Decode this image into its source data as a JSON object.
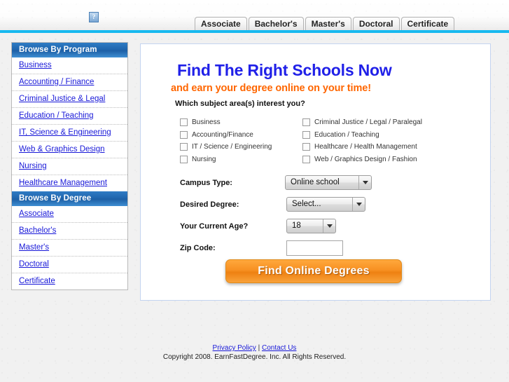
{
  "header": {
    "logo_alt_icon": "broken-image-icon",
    "logo_placeholder_glyph": "?",
    "nav_tabs": [
      {
        "label": "Associate"
      },
      {
        "label": "Bachelor's"
      },
      {
        "label": "Master's"
      },
      {
        "label": "Doctoral"
      },
      {
        "label": "Certificate"
      }
    ],
    "accent_color": "#17b9ef"
  },
  "sidebar": {
    "program_header": "Browse By Program",
    "program_items": [
      {
        "label": "Business"
      },
      {
        "label": "Accounting / Finance"
      },
      {
        "label": "Criminal Justice & Legal"
      },
      {
        "label": "Education / Teaching"
      },
      {
        "label": "IT, Science & Engineering"
      },
      {
        "label": "Web & Graphics Design"
      },
      {
        "label": "Nursing"
      },
      {
        "label": "Healthcare Management"
      }
    ],
    "degree_header": "Browse By Degree",
    "degree_items": [
      {
        "label": "Associate"
      },
      {
        "label": "Bachelor's"
      },
      {
        "label": "Master's"
      },
      {
        "label": "Doctoral"
      },
      {
        "label": "Certificate"
      }
    ],
    "header_color": "#1f65ad",
    "link_color": "#1818d8"
  },
  "main": {
    "heading": "Find The Right Schools Now",
    "subheading": "and earn your degree online on your time!",
    "heading_color": "#2020e8",
    "subheading_color": "#ff6600",
    "subject_prompt": "Which subject area(s) interest you?",
    "subjects_left": [
      {
        "label": "Business",
        "checked": false
      },
      {
        "label": "Accounting/Finance",
        "checked": false
      },
      {
        "label": "IT / Science / Engineering",
        "checked": false
      },
      {
        "label": "Nursing",
        "checked": false
      }
    ],
    "subjects_right": [
      {
        "label": "Criminal Justice / Legal / Paralegal",
        "checked": false
      },
      {
        "label": "Education / Teaching",
        "checked": false
      },
      {
        "label": "Healthcare / Health Management",
        "checked": false
      },
      {
        "label": "Web / Graphics Design / Fashion",
        "checked": false
      }
    ],
    "fields": {
      "campus_label": "Campus Type:",
      "campus_value": "Online school",
      "degree_label": "Desired Degree:",
      "degree_value": "Select...",
      "age_label": "Your Current Age?",
      "age_value": "18",
      "zip_label": "Zip Code:",
      "zip_value": "",
      "zip_placeholder": ""
    },
    "cta_label": "Find Online Degrees",
    "cta_color": "#f79022"
  },
  "footer": {
    "privacy_label": "Privacy Policy",
    "separator": "|",
    "contact_label": "Contact Us",
    "copyright": "Copyright 2008. EarnFastDegree. Inc. All Rights Reserved."
  }
}
